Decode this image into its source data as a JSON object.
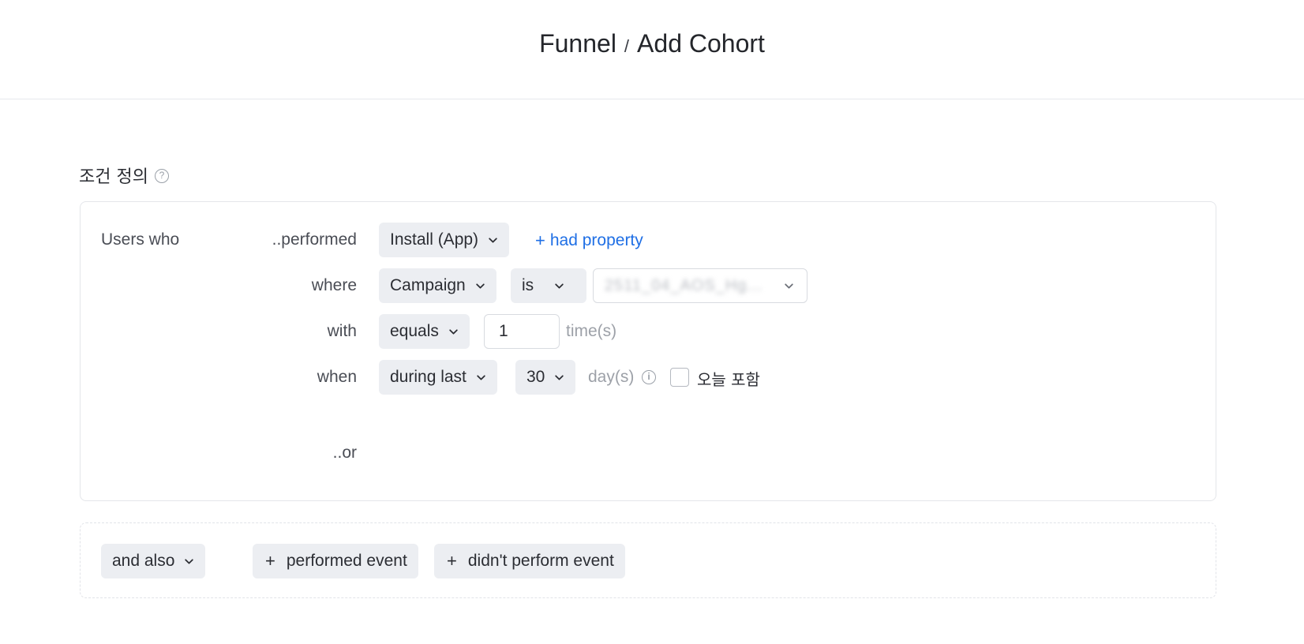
{
  "header": {
    "part1": "Funnel",
    "separator": "/",
    "part2": "Add Cohort"
  },
  "section": {
    "title": "조건 정의",
    "help_glyph": "?"
  },
  "condition": {
    "users_who": "Users who",
    "performed_label": "..performed",
    "event_select": "Install (App)",
    "had_property": "had property",
    "where_label": "where",
    "property_select": "Campaign",
    "operator_select": "is",
    "value_select_blurred": "2511_04_AOS_Hg...",
    "with_label": "with",
    "frequency_select": "equals",
    "count_value": "1",
    "count_unit": "time(s)",
    "when_label": "when",
    "time_select": "during last",
    "days_select": "30",
    "days_unit": "day(s)",
    "info_glyph": "i",
    "include_today_label": "오늘 포함",
    "include_today_checked": false,
    "or_label": "..or"
  },
  "footer": {
    "and_also_select": "and also",
    "performed_event": "performed event",
    "didnt_perform_event": "didn't perform event",
    "plus_glyph": "+"
  },
  "colors": {
    "link": "#1f6fe5",
    "pill_bg": "#eceef2",
    "border": "#e4e6ea"
  }
}
